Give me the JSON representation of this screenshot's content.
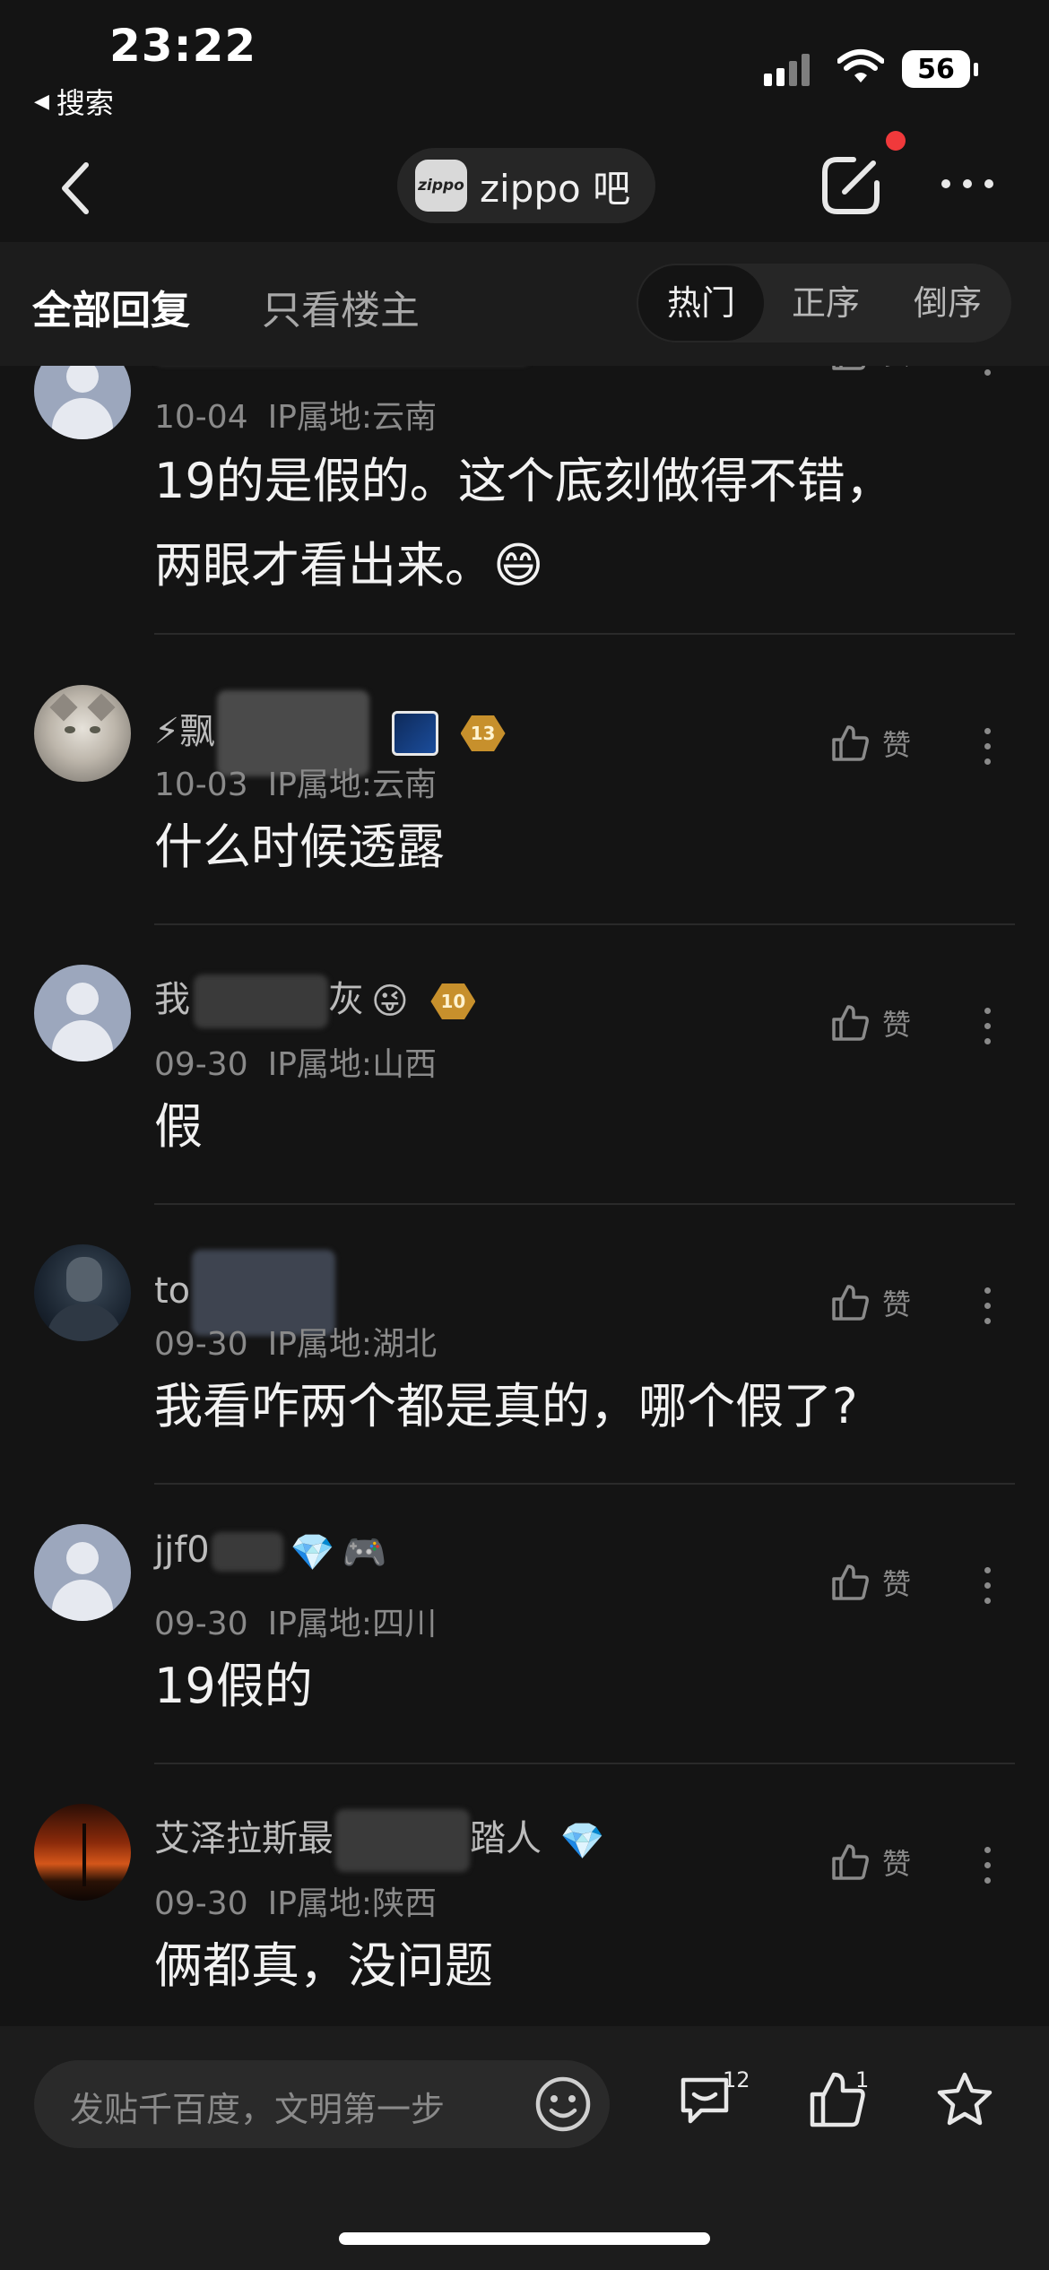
{
  "status_bar": {
    "time": "23:22",
    "back_app": "搜索",
    "battery": "56"
  },
  "nav": {
    "forum_logo": "zippo",
    "forum_name": "zippo 吧"
  },
  "filter": {
    "tab_all": "全部回复",
    "tab_op_only": "只看楼主",
    "sort_hot": "热门",
    "sort_asc": "正序",
    "sort_desc": "倒序"
  },
  "like_label": "赞",
  "comments": [
    {
      "name_visible": "",
      "badge_level": "",
      "date": "10-04",
      "ip": "IP属地:云南",
      "content_lines": [
        "19的是假的。这个底刻做得不错，",
        "两眼才看出来。😄"
      ],
      "avatar": "default"
    },
    {
      "name_visible": "⚡飘",
      "badge_level": "13",
      "date": "10-03",
      "ip": "IP属地:云南",
      "content_lines": [
        "什么时候透露"
      ],
      "avatar": "cat"
    },
    {
      "name_visible": "我",
      "name_suffix": "灰",
      "badge_level": "10",
      "date": "09-30",
      "ip": "IP属地:山西",
      "content_lines": [
        "假"
      ],
      "avatar": "default"
    },
    {
      "name_visible": "to",
      "badge_level": "",
      "date": "09-30",
      "ip": "IP属地:湖北",
      "content_lines": [
        "我看咋两个都是真的，哪个假了?"
      ],
      "avatar": "robot"
    },
    {
      "name_visible": "jjf0",
      "badge_level": "",
      "date": "09-30",
      "ip": "IP属地:四川",
      "content_lines": [
        "19假的"
      ],
      "avatar": "default"
    },
    {
      "name_visible": "艾泽拉斯最",
      "name_suffix": "踏人",
      "badge_level": "",
      "date": "09-30",
      "ip": "IP属地:陕西",
      "content_lines": [
        "俩都真，没问题"
      ],
      "avatar": "sunset"
    }
  ],
  "bottom_bar": {
    "placeholder": "发贴千百度，文明第一步",
    "comment_count": "12",
    "like_count": "1"
  },
  "icons": {
    "back": "chevron-left-icon",
    "edit": "edit-icon",
    "more": "more-horizontal-icon",
    "like": "thumbs-up-icon",
    "kebab": "more-vertical-icon",
    "smile": "emoji-icon",
    "comment": "comment-icon",
    "star": "star-icon"
  },
  "colors": {
    "background": "#141414",
    "bar_background": "#1c1c1c",
    "text_primary": "#f2f2f2",
    "text_secondary": "#8a8a8a",
    "badge_gold": "#c7902c",
    "notification_red": "#f0393b"
  }
}
